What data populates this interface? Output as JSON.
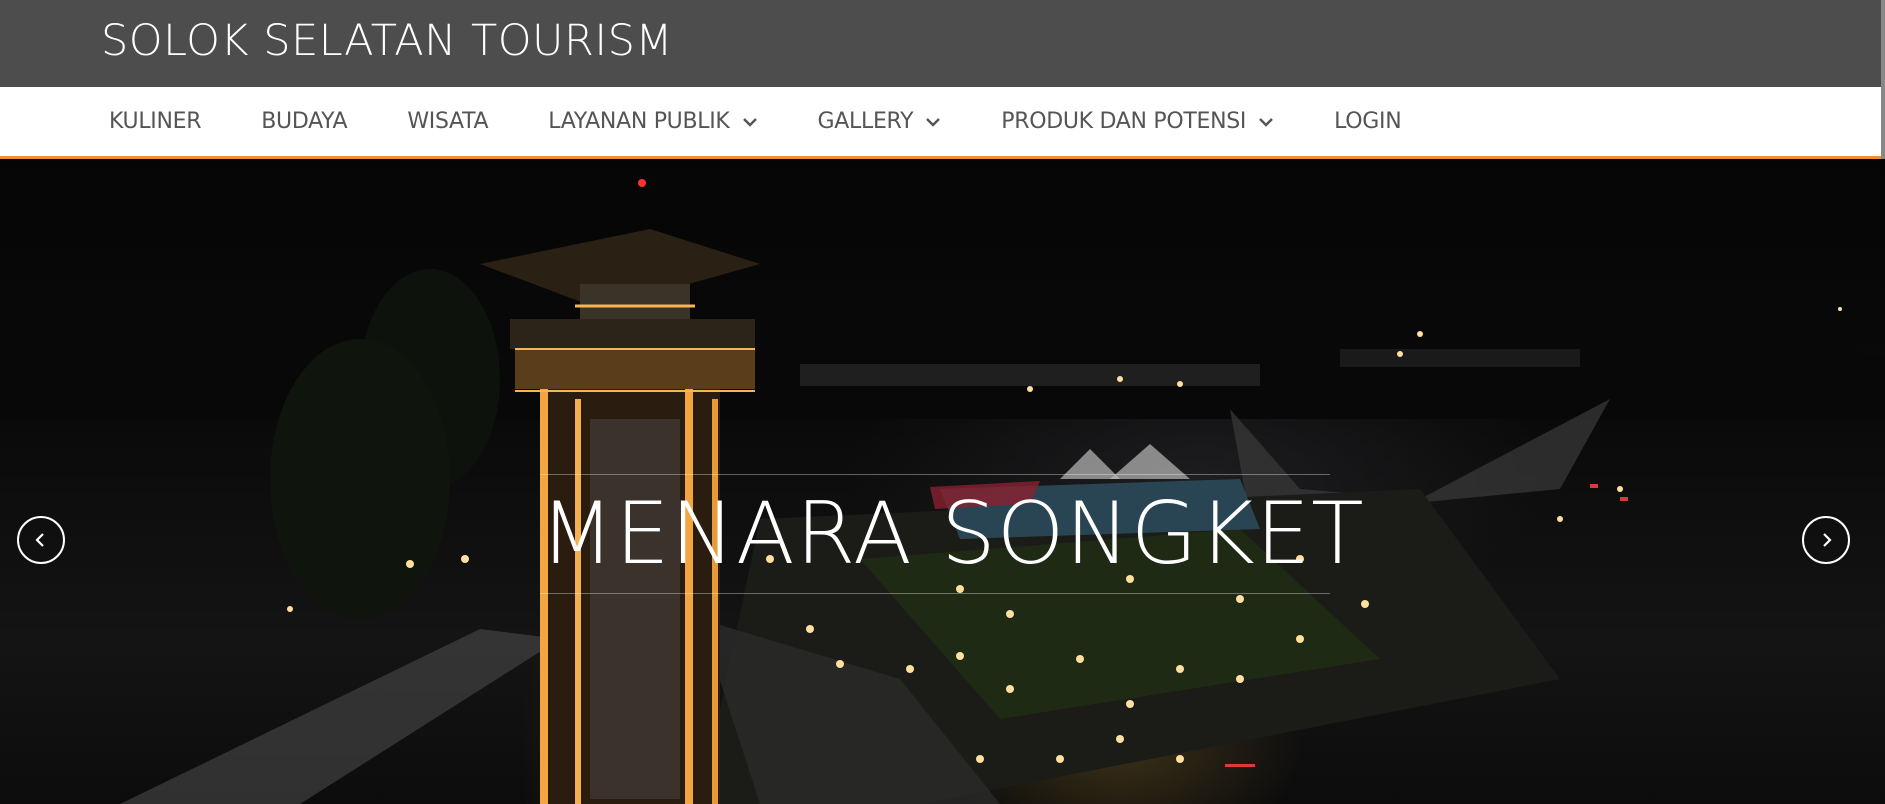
{
  "brand": {
    "title": "SOLOK SELATAN TOURISM"
  },
  "colors": {
    "topbar": "#4d4d4d",
    "nav_accent": "#e8912e",
    "nav_text": "#555555"
  },
  "nav": {
    "items": [
      {
        "label": "KULINER",
        "dropdown": false
      },
      {
        "label": "BUDAYA",
        "dropdown": false
      },
      {
        "label": "WISATA",
        "dropdown": false
      },
      {
        "label": "LAYANAN PUBLIK",
        "dropdown": true
      },
      {
        "label": "GALLERY",
        "dropdown": true
      },
      {
        "label": "PRODUK DAN POTENSI",
        "dropdown": true
      },
      {
        "label": "LOGIN",
        "dropdown": false
      }
    ]
  },
  "hero": {
    "title": "MENARA SONGKET",
    "prev_icon": "chevron-left-icon",
    "next_icon": "chevron-right-icon"
  }
}
